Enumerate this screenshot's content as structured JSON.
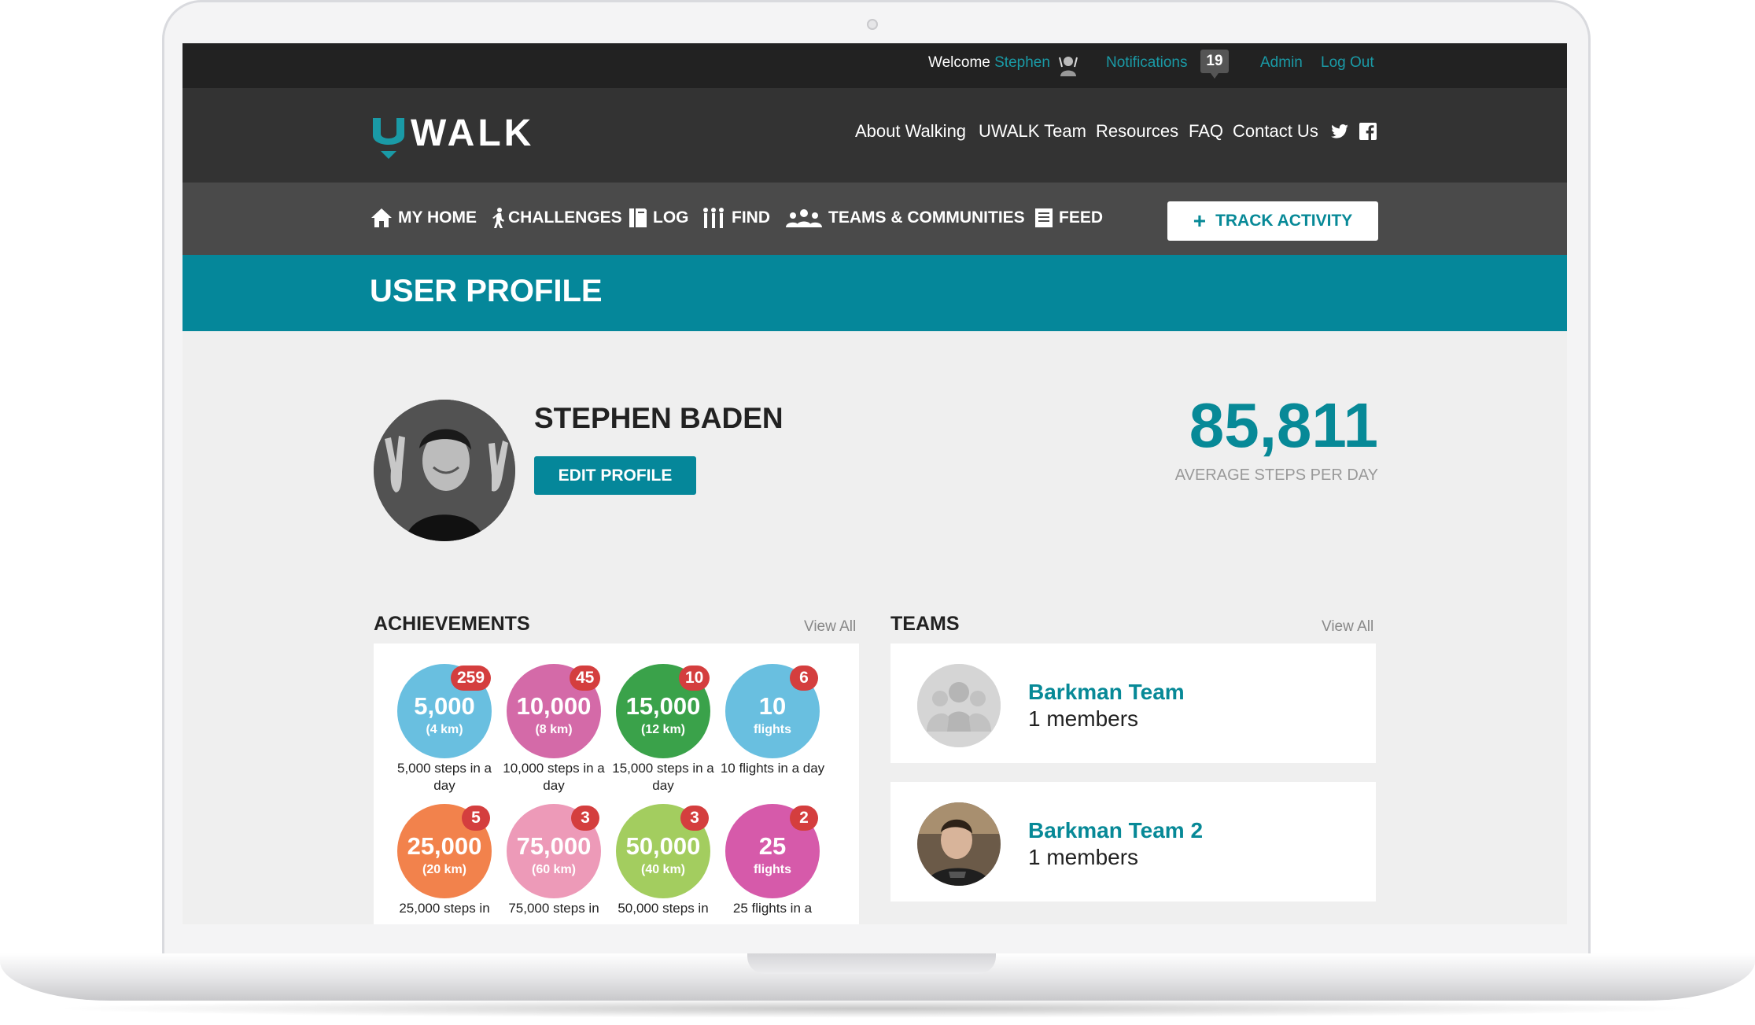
{
  "topbar": {
    "welcome_prefix": "Welcome",
    "welcome_user": "Stephen",
    "notifications_label": "Notifications",
    "notifications_count": "19",
    "admin_label": "Admin",
    "logout_label": "Log Out"
  },
  "header": {
    "logo_text": "WALK",
    "nav": [
      "About Walking",
      "UWALK Team",
      "Resources",
      "FAQ",
      "Contact Us"
    ]
  },
  "subnav": {
    "items": [
      "MY HOME",
      "CHALLENGES",
      "LOG",
      "FIND",
      "TEAMS & COMMUNITIES",
      "FEED"
    ],
    "track_button": "TRACK ACTIVITY"
  },
  "banner": {
    "title": "USER PROFILE"
  },
  "profile": {
    "name": "STEPHEN BADEN",
    "edit_button": "EDIT PROFILE",
    "average_steps": "85,811",
    "average_steps_label": "AVERAGE STEPS PER DAY"
  },
  "achievements": {
    "title": "ACHIEVEMENTS",
    "view_all": "View All",
    "items": [
      {
        "value": "5,000",
        "sub": "(4 km)",
        "count": "259",
        "caption": "5,000 steps in a day",
        "color": "#69bfe0"
      },
      {
        "value": "10,000",
        "sub": "(8 km)",
        "count": "45",
        "caption": "10,000 steps in a day",
        "color": "#d46aa8"
      },
      {
        "value": "15,000",
        "sub": "(12 km)",
        "count": "10",
        "caption": "15,000 steps in a day",
        "color": "#3aa24a"
      },
      {
        "value": "10",
        "sub": "flights",
        "count": "6",
        "caption": "10 flights in a day",
        "color": "#69bfe0"
      },
      {
        "value": "25,000",
        "sub": "(20 km)",
        "count": "5",
        "caption": "25,000 steps in",
        "color": "#f2824c"
      },
      {
        "value": "75,000",
        "sub": "(60 km)",
        "count": "3",
        "caption": "75,000 steps in",
        "color": "#ed9ab8"
      },
      {
        "value": "50,000",
        "sub": "(40 km)",
        "count": "3",
        "caption": "50,000 steps in",
        "color": "#a3cd5f"
      },
      {
        "value": "25",
        "sub": "flights",
        "count": "2",
        "caption": "25 flights in a",
        "color": "#d65aaa"
      }
    ]
  },
  "teams": {
    "title": "TEAMS",
    "view_all": "View All",
    "items": [
      {
        "name": "Barkman Team",
        "members": "1 members"
      },
      {
        "name": "Barkman Team 2",
        "members": "1 members"
      }
    ]
  },
  "colors": {
    "accent": "#05879a",
    "topbar": "#222222",
    "header": "#333333",
    "subnav": "#4a4a4a",
    "count_badge": "#d43e3e"
  }
}
